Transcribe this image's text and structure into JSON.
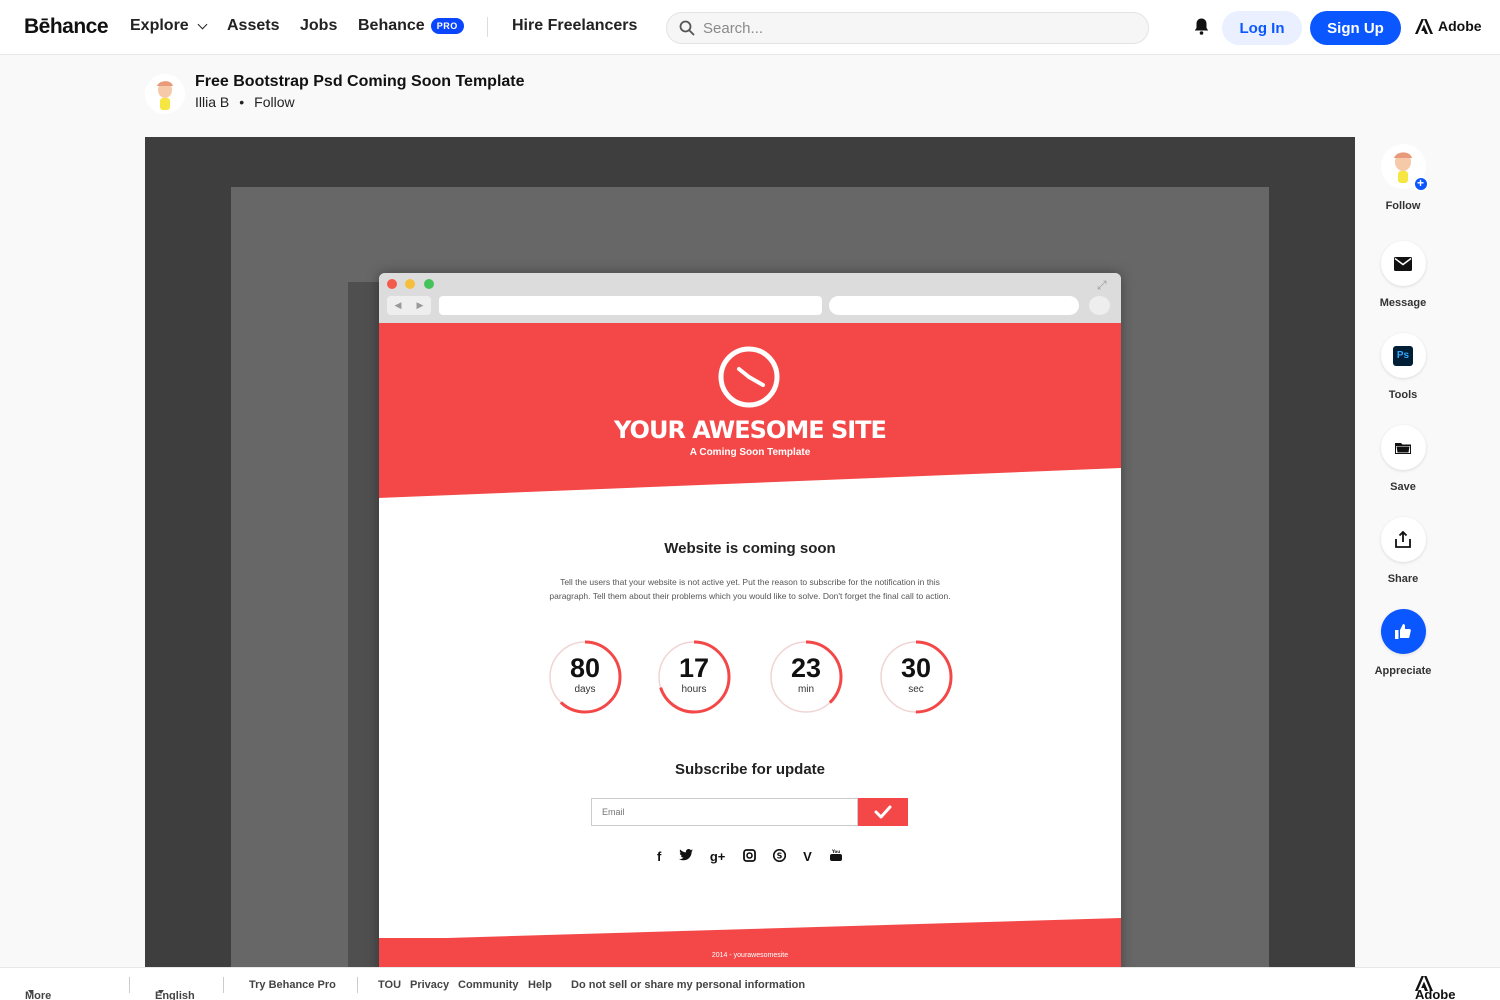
{
  "header": {
    "logo": "Bēhance",
    "nav": [
      {
        "label": "Explore"
      },
      {
        "label": "Assets"
      },
      {
        "label": "Jobs"
      },
      {
        "label": "Behance"
      },
      {
        "label": "Hire Freelancers"
      }
    ],
    "pro_badge": "PRO",
    "search_placeholder": "Search...",
    "login": "Log In",
    "signup": "Sign Up",
    "adobe": "Adobe"
  },
  "project": {
    "title": "Free Bootstrap Psd Coming Soon Template",
    "author": "Illia B",
    "bullet": "•",
    "follow": "Follow"
  },
  "artwork": {
    "site_title": "YOUR AWESOME SITE",
    "site_subtitle": "A Coming Soon Template",
    "heading": "Website is coming soon",
    "paragraph": "Tell the users that your website is not active yet. Put the reason to subscribe for the notification in this paragraph. Tell them about their problems which you would like to solve. Don't forget the final call to action.",
    "counters": [
      {
        "value": "80",
        "unit": "days",
        "progress": 0.62
      },
      {
        "value": "17",
        "unit": "hours",
        "progress": 0.7
      },
      {
        "value": "23",
        "unit": "min",
        "progress": 0.38
      },
      {
        "value": "30",
        "unit": "sec",
        "progress": 0.5
      }
    ],
    "subscribe_heading": "Subscribe for update",
    "email_placeholder": "Email",
    "social_icons": [
      "facebook-icon",
      "twitter-icon",
      "google-plus-icon",
      "instagram-icon",
      "skype-icon",
      "vimeo-icon",
      "youtube-icon"
    ],
    "social_glyphs": [
      "f",
      "🐦",
      "g+",
      "◙",
      "Ⓢ",
      "V",
      "▶"
    ],
    "footer": "2014 - yourawesomesite",
    "accent": "#f44848"
  },
  "rail": [
    {
      "label": "Follow",
      "icon": "avatar"
    },
    {
      "label": "Message",
      "icon": "envelope-icon"
    },
    {
      "label": "Tools",
      "icon": "photoshop-icon",
      "tool_text": "Ps"
    },
    {
      "label": "Save",
      "icon": "folder-icon"
    },
    {
      "label": "Share",
      "icon": "share-icon"
    },
    {
      "label": "Appreciate",
      "icon": "thumbs-up-icon"
    }
  ],
  "footer": {
    "more": "More Behance",
    "language": "English",
    "try_pro": "Try Behance Pro",
    "links": [
      "TOU",
      "Privacy",
      "Community",
      "Help",
      "Do not sell or share my personal information"
    ],
    "adobe": "Adobe"
  },
  "colors": {
    "brand_blue": "#0b57ff",
    "stage_bg": "#3e3e3e"
  }
}
